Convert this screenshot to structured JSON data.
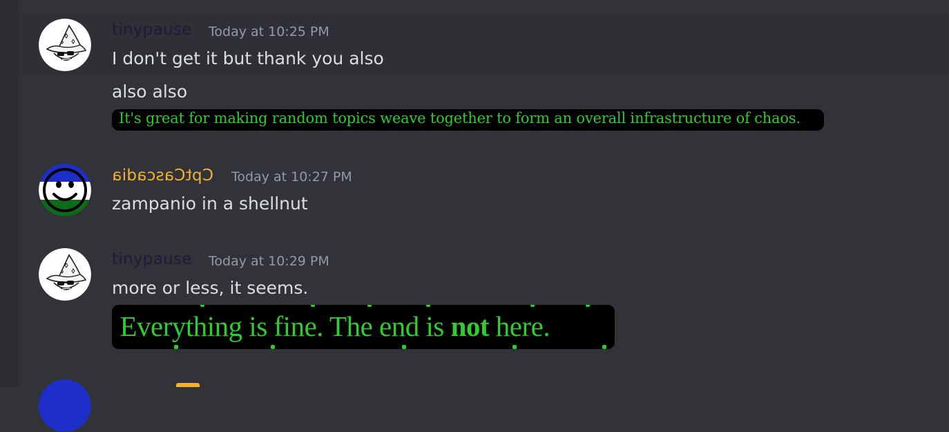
{
  "messages": [
    {
      "author": "tinypause",
      "author_color": "#1f1a3a",
      "timestamp": "Today at 10:25 PM",
      "lines": [
        "I don't get it but thank you also",
        "also also"
      ],
      "quote": "It's great for making random topics weave together to form an overall infrastructure of chaos."
    },
    {
      "author": "CptCascadia",
      "author_color": "#f0b232",
      "timestamp": "Today at 10:27 PM",
      "lines": [
        "zampanio in a shellnut"
      ]
    },
    {
      "author": "tinypause",
      "author_color": "#1f1a3a",
      "timestamp": "Today at 10:29 PM",
      "lines": [
        "more or less, it seems."
      ],
      "image_text": {
        "prefix": ". Everything is fine. The end is ",
        "bold": "not",
        "suffix": " here."
      }
    }
  ],
  "colors": {
    "background": "#313338",
    "text": "#dbdee1",
    "timestamp": "#949ba4",
    "embed_green": "#2ecc2e"
  },
  "icons": {
    "avatar_tinypause": "wizard-hat-sunglasses-face",
    "avatar_cptcascadia": "cascadia-flag-smiley-face"
  }
}
